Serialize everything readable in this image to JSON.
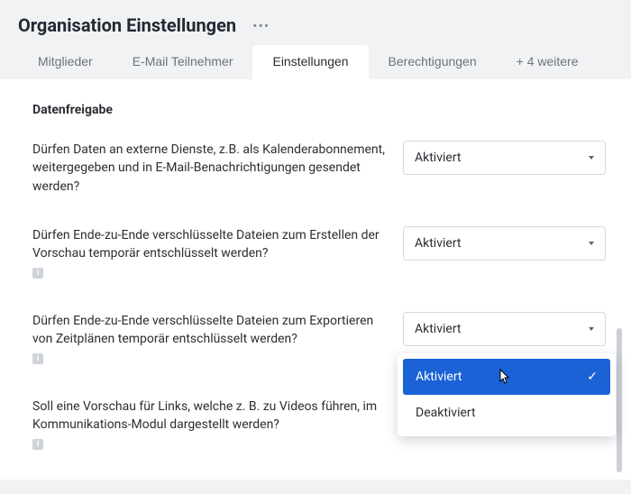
{
  "header": {
    "title": "Organisation Einstellungen",
    "more_label": "more-options"
  },
  "tabs": {
    "items": [
      {
        "label": "Mitglieder"
      },
      {
        "label": "E-Mail Teilnehmer"
      },
      {
        "label": "Einstellungen"
      },
      {
        "label": "Berechtigungen"
      },
      {
        "label": "+ 4 weitere"
      }
    ],
    "active_index": 2
  },
  "section": {
    "title": "Datenfreigabe",
    "settings": [
      {
        "label": "Dürfen Daten an externe Dienste, z.B. als Kalenderabonnement, weitergegeben und in E-Mail-Benachrichtigungen gesendet werden?",
        "value": "Aktiviert",
        "has_info": false
      },
      {
        "label": "Dürfen Ende-zu-Ende verschlüsselte Dateien zum Erstellen der Vorschau temporär entschlüsselt werden?",
        "value": "Aktiviert",
        "has_info": true
      },
      {
        "label": "Dürfen Ende-zu-Ende verschlüsselte Dateien zum Exportieren von Zeitplänen temporär entschlüsselt werden?",
        "value": "Aktiviert",
        "has_info": true
      },
      {
        "label": "Soll eine Vorschau für Links, welche z. B. zu Videos führen, im Kommunikations-Modul dargestellt werden?",
        "value": "",
        "has_info": true
      }
    ]
  },
  "dropdown": {
    "options": [
      {
        "label": "Aktiviert",
        "selected": true
      },
      {
        "label": "Deaktiviert",
        "selected": false
      }
    ]
  }
}
